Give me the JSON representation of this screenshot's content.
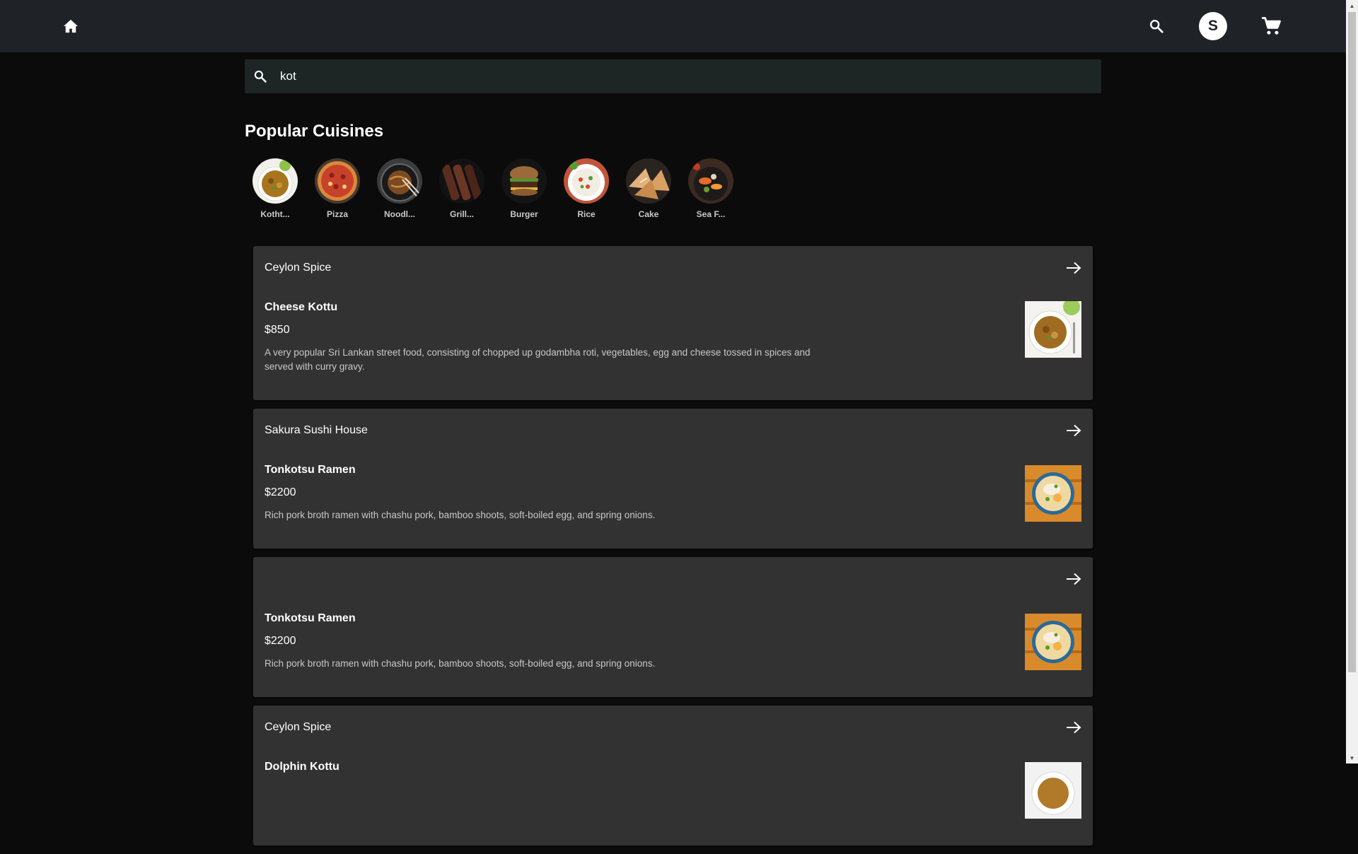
{
  "header": {
    "home_icon": "home-icon",
    "search_icon": "search-icon",
    "avatar_initial": "S",
    "cart_icon": "cart-icon"
  },
  "search": {
    "value": "kot",
    "icon": "search-icon"
  },
  "popular_cuisines": {
    "title": "Popular Cuisines",
    "items": [
      {
        "label": "Kotht..."
      },
      {
        "label": "Pizza"
      },
      {
        "label": "Noodl..."
      },
      {
        "label": "Grill..."
      },
      {
        "label": "Burger"
      },
      {
        "label": "Rice"
      },
      {
        "label": "Cake"
      },
      {
        "label": "Sea F..."
      }
    ]
  },
  "results": [
    {
      "restaurant": "Ceylon Spice",
      "dish": "Cheese Kottu",
      "price": "$850",
      "description": "A very popular Sri Lankan street food, consisting of chopped up godambha roti, vegetables, egg and cheese tossed in spices and served with curry gravy."
    },
    {
      "restaurant": "Sakura Sushi House",
      "dish": "Tonkotsu Ramen",
      "price": "$2200",
      "description": "Rich pork broth ramen with chashu pork, bamboo shoots, soft-boiled egg, and spring onions."
    },
    {
      "restaurant": "",
      "dish": "Tonkotsu Ramen",
      "price": "$2200",
      "description": "Rich pork broth ramen with chashu pork, bamboo shoots, soft-boiled egg, and spring onions."
    },
    {
      "restaurant": "Ceylon Spice",
      "dish": "Dolphin Kottu",
      "price": "",
      "description": ""
    }
  ],
  "colors": {
    "page_bg": "#0b0b0b",
    "topbar_bg": "#1f2226",
    "card_bg": "#323232",
    "search_bg": "#1d2625"
  }
}
